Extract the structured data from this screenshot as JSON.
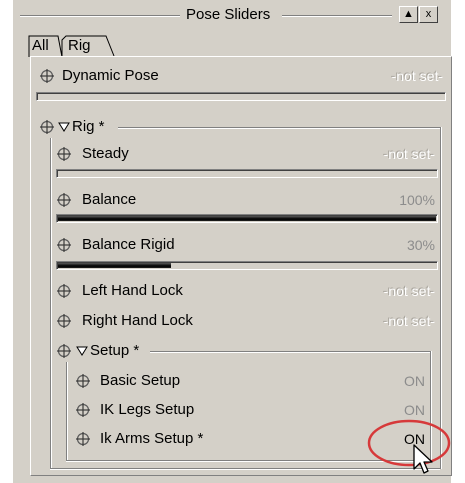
{
  "window": {
    "title": "Pose Sliders",
    "min_label": "▲",
    "close_label": "x"
  },
  "tabs": [
    {
      "label": "All"
    },
    {
      "label": "Rig"
    }
  ],
  "rows": {
    "dynamic_pose": {
      "label": "Dynamic Pose",
      "status": "-not set-",
      "slider_fraction": 0
    },
    "rig": {
      "label": "Rig *"
    },
    "steady": {
      "label": "Steady",
      "status": "-not set-",
      "slider_fraction": 0
    },
    "balance": {
      "label": "Balance",
      "status": "100%",
      "slider_fraction": 1.0
    },
    "balance_rigid": {
      "label": "Balance Rigid",
      "status": "30%",
      "slider_fraction": 0.3
    },
    "left_hand": {
      "label": "Left Hand Lock",
      "status": "-not set-"
    },
    "right_hand": {
      "label": "Right Hand Lock",
      "status": "-not set-"
    },
    "setup": {
      "label": "Setup *"
    },
    "basic_setup": {
      "label": "Basic Setup",
      "status": "ON"
    },
    "ik_legs": {
      "label": "IK Legs Setup",
      "status": "ON"
    },
    "ik_arms": {
      "label": "Ik Arms Setup *",
      "status": "ON"
    }
  },
  "icons": {
    "pose_icon": "move-cross-icon",
    "expand_icon": "triangle-down-icon",
    "cursor": "mouse-pointer-icon"
  },
  "colors": {
    "panel_bg": "#d4d0c8",
    "highlight_ellipse": "#d6393a"
  }
}
